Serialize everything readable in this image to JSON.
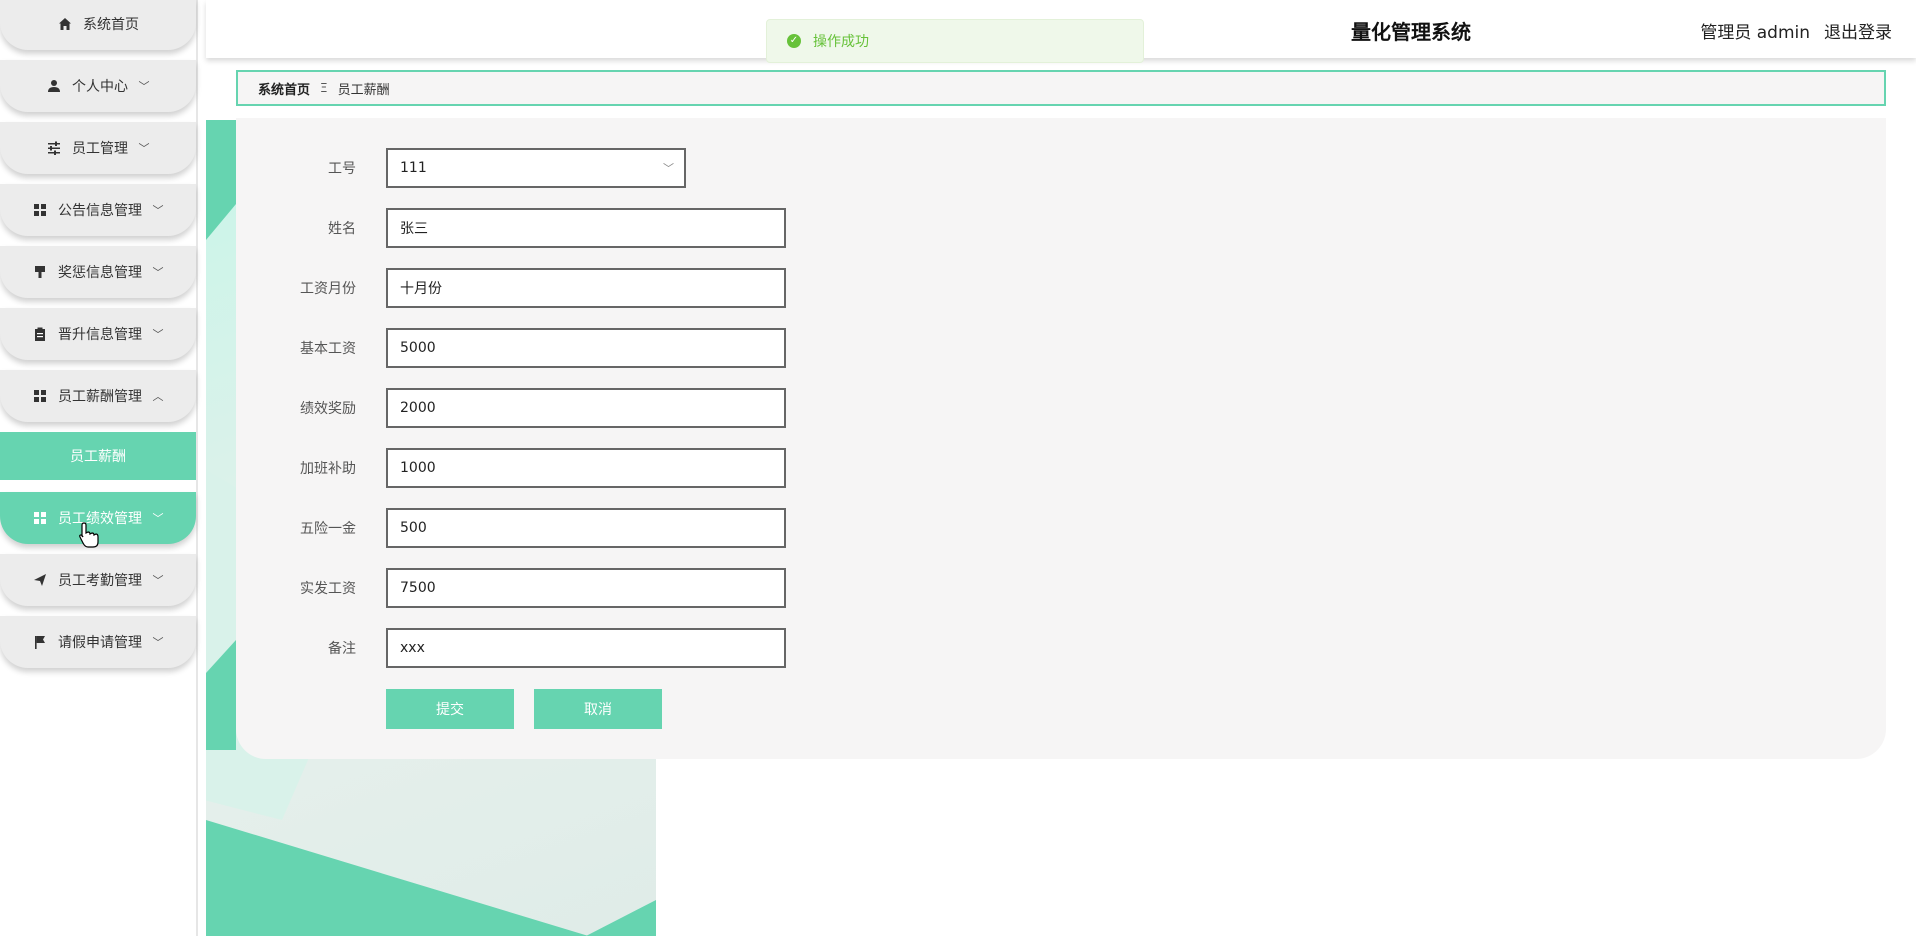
{
  "header": {
    "title": "量化管理系统",
    "user_label": "管理员 admin",
    "logout_label": "退出登录"
  },
  "toast": {
    "message": "操作成功"
  },
  "breadcrumb": {
    "home": "系统首页",
    "separator": "Ξ",
    "current": "员工薪酬"
  },
  "sidebar": {
    "items": [
      {
        "label": "系统首页",
        "icon": "home-icon",
        "expandable": false
      },
      {
        "label": "个人中心",
        "icon": "user-icon",
        "expandable": true
      },
      {
        "label": "员工管理",
        "icon": "sliders-icon",
        "expandable": true
      },
      {
        "label": "公告信息管理",
        "icon": "grid-icon",
        "expandable": true
      },
      {
        "label": "奖惩信息管理",
        "icon": "brush-icon",
        "expandable": true
      },
      {
        "label": "晋升信息管理",
        "icon": "clipboard-icon",
        "expandable": true
      },
      {
        "label": "员工薪酬管理",
        "icon": "grid-icon",
        "expandable": true,
        "expanded": true
      },
      {
        "label": "员工绩效管理",
        "icon": "grid-icon",
        "expandable": true,
        "active": true
      },
      {
        "label": "员工考勤管理",
        "icon": "send-icon",
        "expandable": true
      },
      {
        "label": "请假申请管理",
        "icon": "flag-icon",
        "expandable": true
      }
    ],
    "submenu": {
      "label": "员工薪酬"
    }
  },
  "form": {
    "fields": [
      {
        "label": "工号",
        "value": "111",
        "type": "select"
      },
      {
        "label": "姓名",
        "value": "张三"
      },
      {
        "label": "工资月份",
        "value": "十月份"
      },
      {
        "label": "基本工资",
        "value": "5000"
      },
      {
        "label": "绩效奖励",
        "value": "2000"
      },
      {
        "label": "加班补助",
        "value": "1000"
      },
      {
        "label": "五险一金",
        "value": "500"
      },
      {
        "label": "实发工资",
        "value": "7500"
      },
      {
        "label": "备注",
        "value": "xxx"
      }
    ],
    "submit_label": "提交",
    "cancel_label": "取消"
  },
  "colors": {
    "accent": "#66d4b0",
    "success": "#67c23a"
  }
}
